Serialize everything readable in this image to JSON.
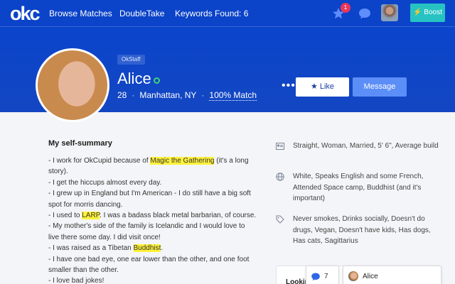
{
  "nav": {
    "logo": "okc",
    "browse_matches": "Browse Matches",
    "doubletake": "DoubleTake",
    "keywords_found": "Keywords Found: 6",
    "notification_count": "1",
    "boost": "Boost"
  },
  "profile": {
    "badge": "OkStaff",
    "name": "Alice",
    "age": "28",
    "location": "Manhattan, NY",
    "match": "100% Match",
    "like_label": "Like",
    "message_label": "Message"
  },
  "summary": {
    "title": "My self-summary",
    "lines": [
      [
        "- I work for OkCupid because of ",
        "Magic the Gathering",
        " (it's a long"
      ],
      [
        "story)."
      ],
      [
        "- I get the hiccups almost every day."
      ],
      [
        "- I grew up in England but I'm American - I do still have a big soft"
      ],
      [
        "spot for morris dancing."
      ],
      [
        "- I used to ",
        "LARP",
        ". I was a badass black metal barbarian, of course."
      ],
      [
        "- My mother's side of the family is Icelandic and I would love to"
      ],
      [
        "live there some day. I did visit once!"
      ],
      [
        "- I was raised as a Tibetan ",
        "Buddhist",
        "."
      ],
      [
        "- I have one bad eye, one ear lower than the other, and one foot"
      ],
      [
        "smaller than the other."
      ],
      [
        "- I love bad jokes!"
      ]
    ]
  },
  "details": [
    {
      "icon": "id-card-icon",
      "text": "Straight, Woman, Married, 5' 6\", Average build"
    },
    {
      "icon": "globe-icon",
      "text": "White, Speaks English and some French, Attended Space camp, Buddhist (and it's important)"
    },
    {
      "icon": "tag-icon",
      "text": "Never smokes, Drinks socially, Doesn't do drugs, Vegan, Doesn't have kids, Has dogs, Has cats, Sagittarius"
    }
  ],
  "looking_for": "Lookin",
  "chat": {
    "count": "7",
    "name": "Alice"
  },
  "colors": {
    "brand_blue": "#0b43c9",
    "highlight": "#fff23a",
    "boost": "#27c3c3",
    "message_button": "#5b8ef7"
  }
}
